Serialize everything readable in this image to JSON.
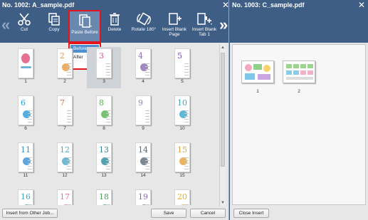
{
  "left_window": {
    "title": "No. 1002: A_sample.pdf",
    "toolbar": {
      "cut": "Cut",
      "copy": "Copy",
      "paste_before": "Paste Before",
      "delete": "Delete",
      "rotate": "Rotate 180°",
      "insert_blank_page_l1": "Insert Blank",
      "insert_blank_page_l2": "Page",
      "insert_blank_tab_l1": "Insert Blank",
      "insert_blank_tab_l2": "Tab 1"
    },
    "paste_menu": {
      "options": [
        "Before",
        "After"
      ],
      "selected": "Before"
    },
    "pages": [
      {
        "n": "1",
        "label": "1",
        "content": "cover",
        "accent": "#e86f8f"
      },
      {
        "n": "2",
        "label": "2",
        "content": "2",
        "accent": "#e99a3a"
      },
      {
        "n": "3",
        "label": "3",
        "content": "3",
        "accent": "#d95a79"
      },
      {
        "n": "4",
        "label": "4",
        "content": "4",
        "accent": "#8b6ab0"
      },
      {
        "n": "5",
        "label": "5",
        "content": "5",
        "accent": "#7b4dbd"
      },
      {
        "n": "6",
        "label": "6",
        "content": "6",
        "accent": "#2f9ad6"
      },
      {
        "n": "7",
        "label": "7",
        "content": "7",
        "accent": "#e76e3e"
      },
      {
        "n": "8",
        "label": "8",
        "content": "8",
        "accent": "#58b050"
      },
      {
        "n": "9",
        "label": "9",
        "content": "9",
        "accent": "#9b7bc6"
      },
      {
        "n": "10",
        "label": "10",
        "content": "10",
        "accent": "#3aa5c9"
      },
      {
        "n": "11",
        "label": "11",
        "content": "11",
        "accent": "#3a8fd0"
      },
      {
        "n": "12",
        "label": "12",
        "content": "12",
        "accent": "#4ba8c8"
      },
      {
        "n": "13",
        "label": "13",
        "content": "13",
        "accent": "#2a8a9a"
      },
      {
        "n": "14",
        "label": "14",
        "content": "14",
        "accent": "#586978"
      },
      {
        "n": "15",
        "label": "15",
        "content": "15",
        "accent": "#e2a43a"
      },
      {
        "n": "16",
        "label": "",
        "content": "16",
        "accent": "#3aa8c9"
      },
      {
        "n": "17",
        "label": "",
        "content": "17",
        "accent": "#e27499"
      },
      {
        "n": "18",
        "label": "",
        "content": "18",
        "accent": "#48a05a"
      },
      {
        "n": "19",
        "label": "",
        "content": "19",
        "accent": "#8c6aaf"
      },
      {
        "n": "20",
        "label": "",
        "content": "20",
        "accent": "#e0b030"
      }
    ],
    "selected_page": "3",
    "footer": {
      "insert_from_other_job": "Insert from Other Job...",
      "save": "Save",
      "cancel": "Cancel"
    }
  },
  "right_window": {
    "title": "No. 1003: C_sample.pdf",
    "pages": [
      {
        "label": "1"
      },
      {
        "label": "2"
      }
    ],
    "footer": {
      "close_insert": "Close Insert"
    }
  },
  "colors": {
    "toolbar_bg": "#3e5e86",
    "highlight_border": "#e2141d",
    "menu_selected": "#4e8fd0"
  }
}
